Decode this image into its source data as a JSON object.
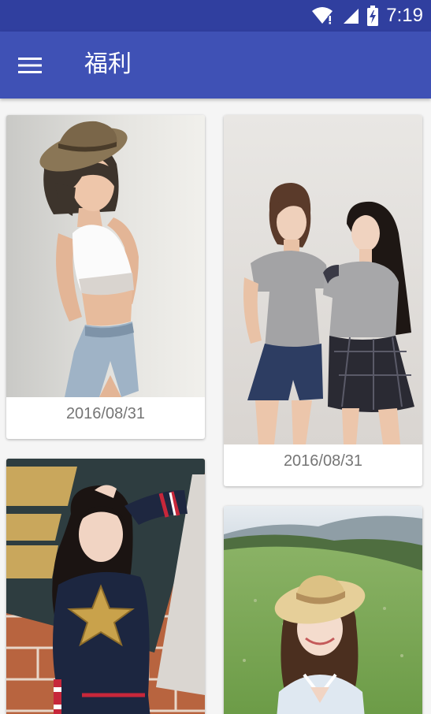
{
  "status_bar": {
    "time": "7:19",
    "icons": [
      "wifi-icon",
      "signal-icon",
      "battery-charging-icon"
    ]
  },
  "app_bar": {
    "title": "福利",
    "menu_icon": "menu-icon"
  },
  "cards": [
    {
      "date": "2016/08/31"
    },
    {
      "date": "2016/08/31"
    },
    {
      "date": ""
    },
    {
      "date": ""
    }
  ],
  "colors": {
    "status_bar": "#303f9f",
    "primary": "#3f51b5",
    "background": "#f5f5f5",
    "date_text": "#757575"
  }
}
